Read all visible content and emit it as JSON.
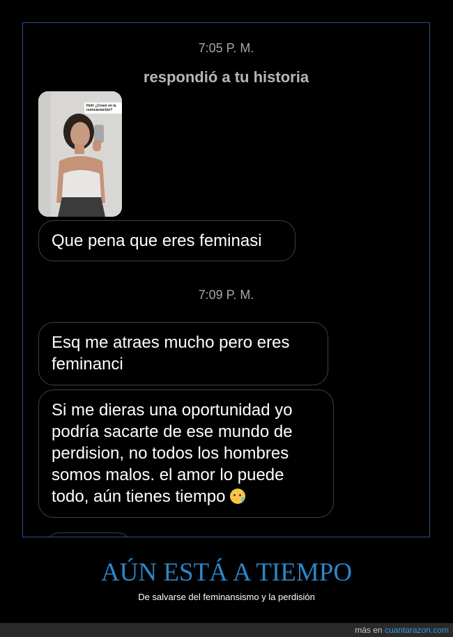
{
  "chat": {
    "timestamp_1": "7:05 P. M.",
    "reply_label": "respondió a tu historia",
    "story_caption": "Holi! ¿Creen en la reencarnación?",
    "message_1": "Que pena que eres feminasi",
    "timestamp_2": "7:09 P. M.",
    "message_2": "Esq me atraes mucho pero eres\nfeminanci",
    "message_3": "Si me dieras una oportunidad yo\npodría sacarte de ese mundo de\nperdision, no todos los hombres\nsomos malos. el amor lo puede\ntodo, aún tienes tiempo"
  },
  "meme": {
    "headline": "AÚN ESTÁ A TIEMPO",
    "subtitle": "De salvarse del feminansismo y la perdisión"
  },
  "footer": {
    "prefix": "más en ",
    "site": "cuantarazon.com"
  },
  "colors": {
    "frame_border": "#2f4e8f",
    "headline": "#2b86c8",
    "bubble_border": "#404040"
  }
}
